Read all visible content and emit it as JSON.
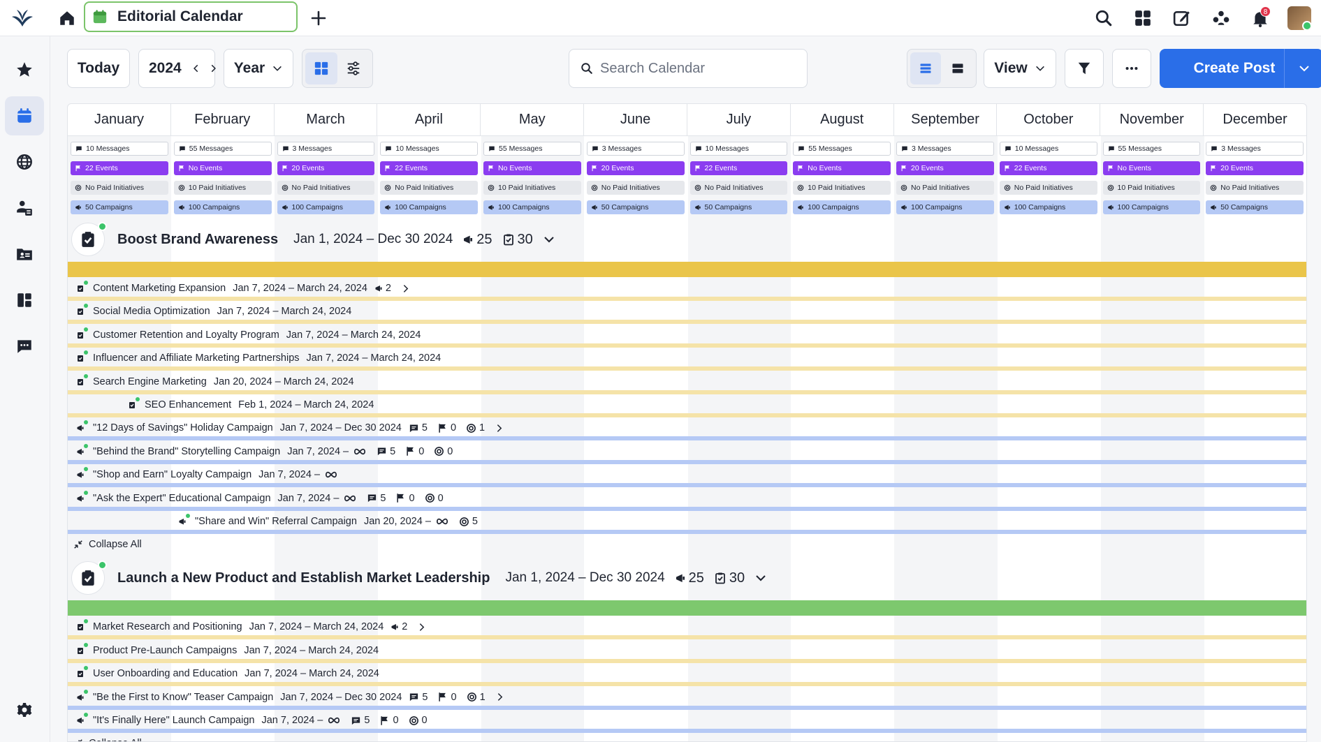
{
  "app": {
    "title": "Editorial Calendar"
  },
  "notifications": {
    "count": "8"
  },
  "toolbar": {
    "today": "Today",
    "year": "2024",
    "range": "Year",
    "search_placeholder": "Search Calendar",
    "view": "View",
    "create": "Create Post"
  },
  "months": [
    "January",
    "February",
    "March",
    "April",
    "May",
    "June",
    "July",
    "August",
    "September",
    "October",
    "November",
    "December"
  ],
  "stats": {
    "messages": [
      "10 Messages",
      "55 Messages",
      "3 Messages",
      "10 Messages",
      "55 Messages",
      "3 Messages",
      "10 Messages",
      "55 Messages",
      "3 Messages",
      "10 Messages",
      "55 Messages",
      "3 Messages"
    ],
    "events": [
      "22 Events",
      "No Events",
      "20 Events",
      "22 Events",
      "No Events",
      "20 Events",
      "22 Events",
      "No Events",
      "20 Events",
      "22 Events",
      "No Events",
      "20 Events"
    ],
    "paid": [
      "No Paid Initiatives",
      "10 Paid Initiatives",
      "No Paid Initiatives",
      "No Paid Initiatives",
      "10 Paid Initiatives",
      "No Paid Initiatives",
      "No Paid Initiatives",
      "10 Paid Initiatives",
      "No Paid Initiatives",
      "No Paid Initiatives",
      "10 Paid Initiatives",
      "No Paid Initiatives"
    ],
    "campaigns": [
      "50 Campaigns",
      "100 Campaigns",
      "100 Campaigns",
      "100 Campaigns",
      "100 Campaigns",
      "50 Campaigns",
      "50 Campaigns",
      "100 Campaigns",
      "100 Campaigns",
      "100 Campaigns",
      "100 Campaigns",
      "50 Campaigns"
    ]
  },
  "goals": [
    {
      "title": "Boost Brand Awareness",
      "range": "Jan 1, 2024 – Dec 30 2024",
      "campaign_count": "25",
      "task_count": "30",
      "bar_color": "#eac54a",
      "collapse_label": "Collapse All",
      "rows": [
        {
          "kind": "initiative",
          "indent": 0,
          "title": "Content Marketing Expansion",
          "date": "Jan 7, 2024 – March 24, 2024",
          "campaigns": "2",
          "chevron": true
        },
        {
          "kind": "initiative",
          "indent": 0,
          "title": "Social Media Optimization",
          "date": "Jan 7, 2024 – March 24, 2024"
        },
        {
          "kind": "initiative",
          "indent": 0,
          "title": "Customer Retention and Loyalty Program",
          "date": "Jan 7, 2024 – March 24, 2024"
        },
        {
          "kind": "initiative",
          "indent": 0,
          "title": "Influencer and Affiliate Marketing Partnerships",
          "date": "Jan 7, 2024 – March 24, 2024"
        },
        {
          "kind": "initiative",
          "indent": 1,
          "title": "Search Engine Marketing",
          "date": "Jan 20, 2024 – March 24, 2024"
        },
        {
          "kind": "initiative",
          "indent": 2,
          "title": "SEO Enhancement",
          "date": "Feb 1, 2024 – March 24, 2024"
        },
        {
          "kind": "campaign",
          "indent": 0,
          "title": "\"12 Days of Savings\" Holiday Campaign",
          "date": "Jan 7, 2024 – Dec 30 2024",
          "messages": "5",
          "events": "0",
          "paid": "1",
          "chevron": true
        },
        {
          "kind": "campaign",
          "indent": 0,
          "title": "\"Behind the Brand\" Storytelling Campaign",
          "date": "Jan 7, 2024 –",
          "infinite": true,
          "messages": "5",
          "events": "0",
          "paid": "0"
        },
        {
          "kind": "campaign",
          "indent": 0,
          "title": "\"Shop and Earn\" Loyalty Campaign",
          "date": "Jan 7, 2024 –",
          "infinite": true
        },
        {
          "kind": "campaign",
          "indent": 0,
          "title": "\"Ask the Expert\" Educational Campaign",
          "date": "Jan 7, 2024 –",
          "infinite": true,
          "messages": "5",
          "events": "0",
          "paid": "0"
        },
        {
          "kind": "campaign",
          "indent": 3,
          "title": "\"Share and Win\" Referral Campaign",
          "date": "Jan 20, 2024 –",
          "infinite": true,
          "paid": "5"
        }
      ]
    },
    {
      "title": "Launch a New Product and Establish Market Leadership",
      "range": "Jan 1, 2024 – Dec 30 2024",
      "campaign_count": "25",
      "task_count": "30",
      "bar_color": "#7dc86e",
      "collapse_label": "Collapse All",
      "rows": [
        {
          "kind": "initiative",
          "indent": 0,
          "title": "Market Research and Positioning",
          "date": "Jan 7, 2024 – March 24, 2024",
          "campaigns": "2",
          "chevron": true
        },
        {
          "kind": "initiative",
          "indent": 0,
          "title": "Product Pre-Launch Campaigns",
          "date": "Jan 7, 2024 – March 24, 2024"
        },
        {
          "kind": "initiative",
          "indent": 0,
          "title": "User Onboarding and Education",
          "date": "Jan 7, 2024 – March 24, 2024"
        },
        {
          "kind": "campaign",
          "indent": 0,
          "title": "\"Be the First to Know\" Teaser Campaign",
          "date": "Jan 7, 2024 – Dec 30 2024",
          "messages": "5",
          "events": "0",
          "paid": "1",
          "chevron": true
        },
        {
          "kind": "campaign",
          "indent": 0,
          "title": "\"It's Finally Here\" Launch Campaign",
          "date": "Jan 7, 2024 –",
          "infinite": true,
          "messages": "5",
          "events": "0",
          "paid": "0"
        }
      ]
    }
  ],
  "colors": {
    "primary": "#2a6ee8",
    "event_chip": "#8b3df0",
    "campaign_chip": "#b5c9f5",
    "initiative_line": "#f5e3a8",
    "campaign_line": "#b5c9f5",
    "online_dot": "#3cc46a"
  }
}
